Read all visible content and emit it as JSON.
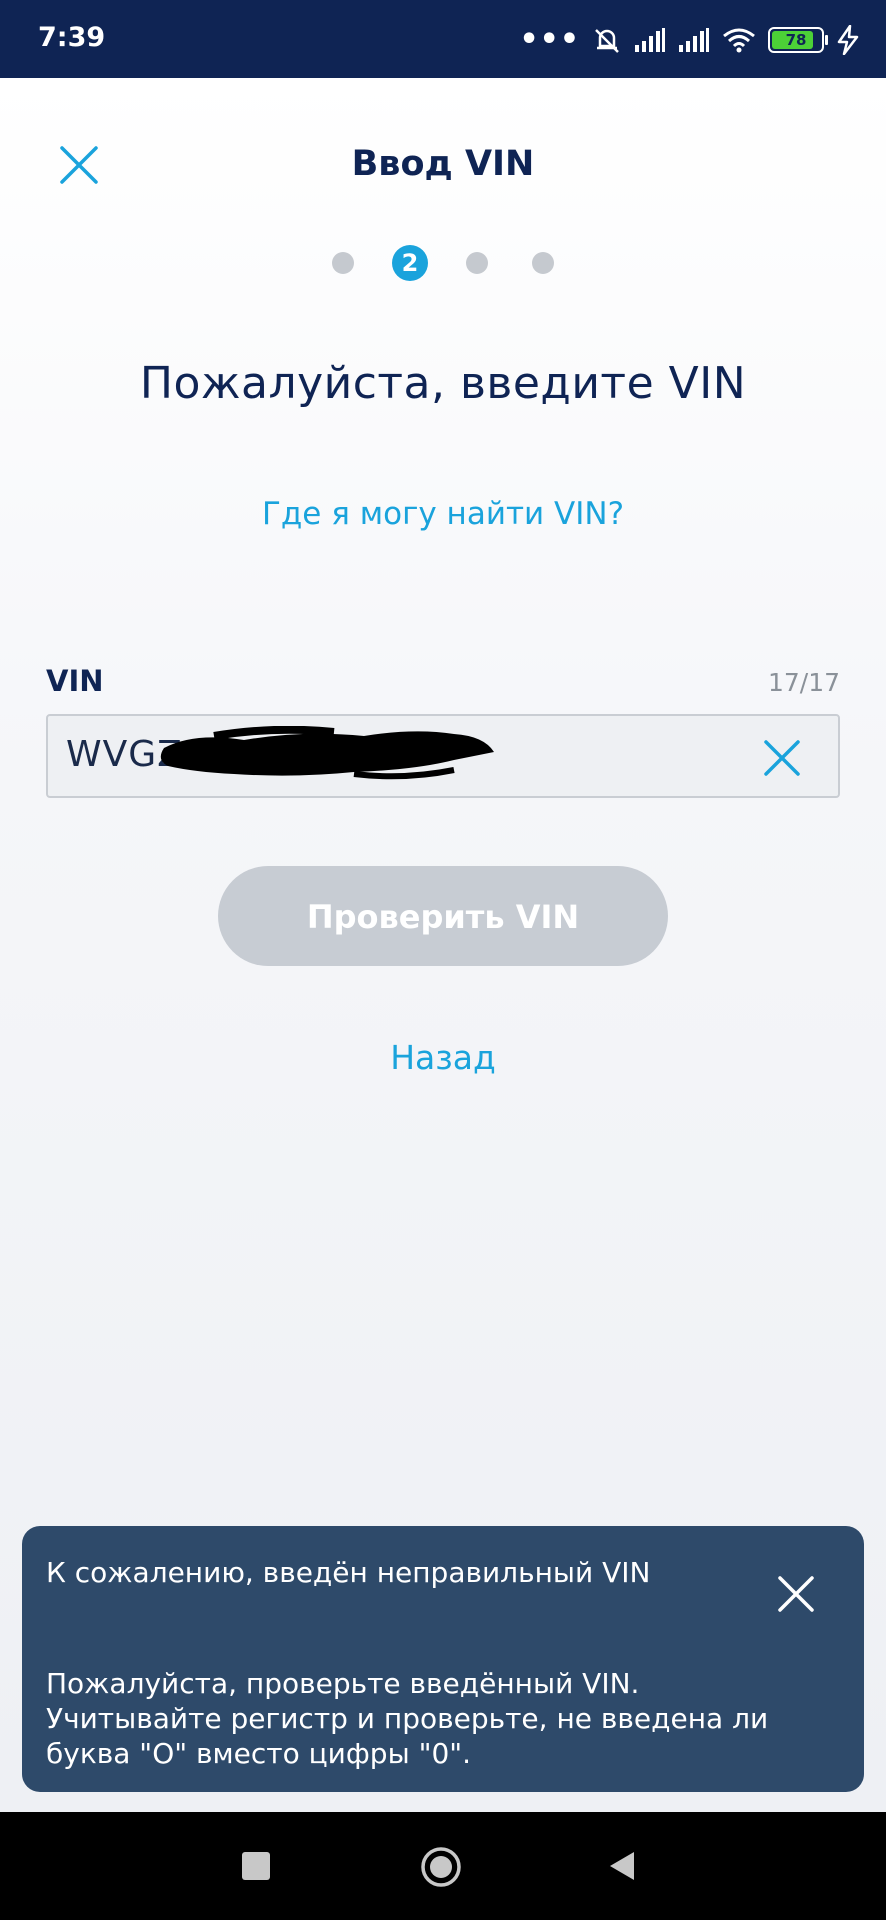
{
  "status_bar": {
    "time": "7:39",
    "dots": "•••",
    "battery_percent": "78"
  },
  "header": {
    "title": "Ввод VIN",
    "current_step": "2"
  },
  "main": {
    "heading": "Пожалуйста, введите VIN",
    "help_link": "Где я могу найти VIN?",
    "vin_label": "VIN",
    "vin_counter": "17/17",
    "vin_value": "WVGZ",
    "check_button": "Проверить VIN",
    "back_link": "Назад"
  },
  "toast": {
    "title": "К сожалению, введён неправильный VIN",
    "body_lines": [
      "Пожалуйста, проверьте введённый VIN.",
      "Учитывайте регистр и проверьте, не введена ли",
      "буква \"O\" вместо цифры \"0\"."
    ]
  },
  "colors": {
    "accent": "#1aa3dc",
    "navy": "#0f2454",
    "toast_bg": "#2e4a6a",
    "button_disabled": "#c7ccd3"
  },
  "icons": [
    "close-icon",
    "clear-icon",
    "toast-close-icon",
    "signal-icon",
    "wifi-icon",
    "battery-icon",
    "charging-icon",
    "mute-icon"
  ]
}
